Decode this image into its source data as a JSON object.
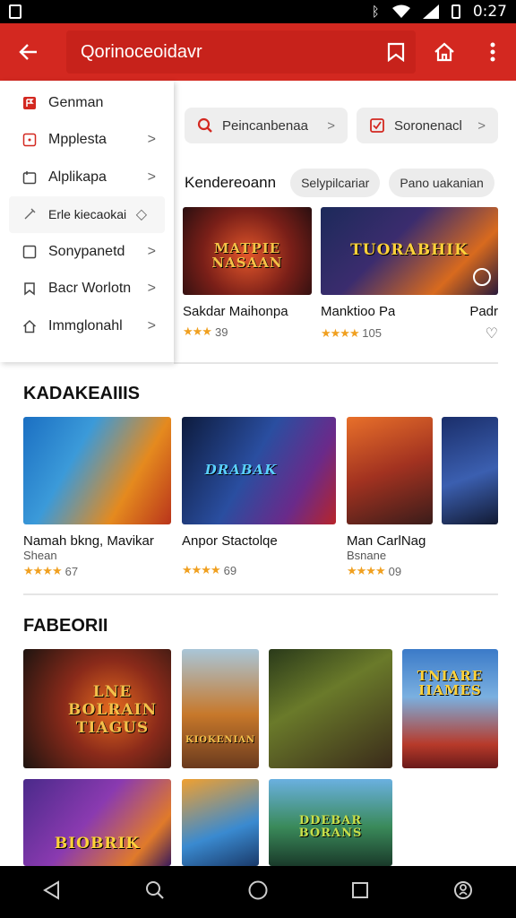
{
  "status_bar": {
    "time": "0:27"
  },
  "app_bar": {
    "search_text": "Qorinoceoidavr"
  },
  "drawer": {
    "items": [
      {
        "label": "Genman",
        "icon": "flag-icon",
        "active": true
      },
      {
        "label": "Mpplesta",
        "icon": "calendar-icon"
      },
      {
        "label": "Alplikapa",
        "icon": "app-icon"
      },
      {
        "label": "Erle kiecaokai",
        "icon": "edit-icon"
      },
      {
        "label": "Sonypanetd",
        "icon": "square-icon"
      },
      {
        "label": "Bacr Worlotn",
        "icon": "bookmark-icon"
      },
      {
        "label": "Immglonahl",
        "icon": "home-icon"
      }
    ]
  },
  "filter_chips": [
    {
      "label": "Peincanbenaa",
      "icon": "search-icon"
    },
    {
      "label": "Soronenacl",
      "icon": "checklist-icon"
    }
  ],
  "featured": {
    "title": "Kendereoann",
    "pills": [
      "Selypilcariar",
      "Pano uakanian"
    ],
    "cards": [
      {
        "name": "Sakdar Maihonpa",
        "rating": "39",
        "art_text": "MATPIE NASAAN"
      },
      {
        "name": "Manktioo Pa",
        "rating": "105",
        "art_text": "TUORABHIK"
      },
      {
        "name": "Padr",
        "rating": ""
      }
    ]
  },
  "section2": {
    "title": "KADAKEAIIIS",
    "cards": [
      {
        "name": "Namah bkng, Mavikar",
        "sub": "Shean",
        "rating": "67",
        "art_text": ""
      },
      {
        "name": "Anpor Stactolqe",
        "sub": "",
        "rating": "69",
        "art_text": "DRABAK"
      },
      {
        "name": "Man CarlNag",
        "sub": "Bsnane",
        "rating": "09",
        "art_text": ""
      },
      {
        "name": "",
        "sub": "",
        "rating": "",
        "art_text": ""
      }
    ]
  },
  "section3": {
    "title": "FABEORII",
    "row1": [
      {
        "art_text": "LNE BOLRAIN TIAGUS"
      },
      {
        "art_text": "KIOKENIAN"
      },
      {
        "art_text": ""
      },
      {
        "art_text": "TNIARE IIAMES"
      }
    ],
    "row2": [
      {
        "art_text": "BIOBRIK"
      },
      {
        "art_text": ""
      },
      {
        "art_text": "DDEBAR BORANS"
      }
    ]
  }
}
